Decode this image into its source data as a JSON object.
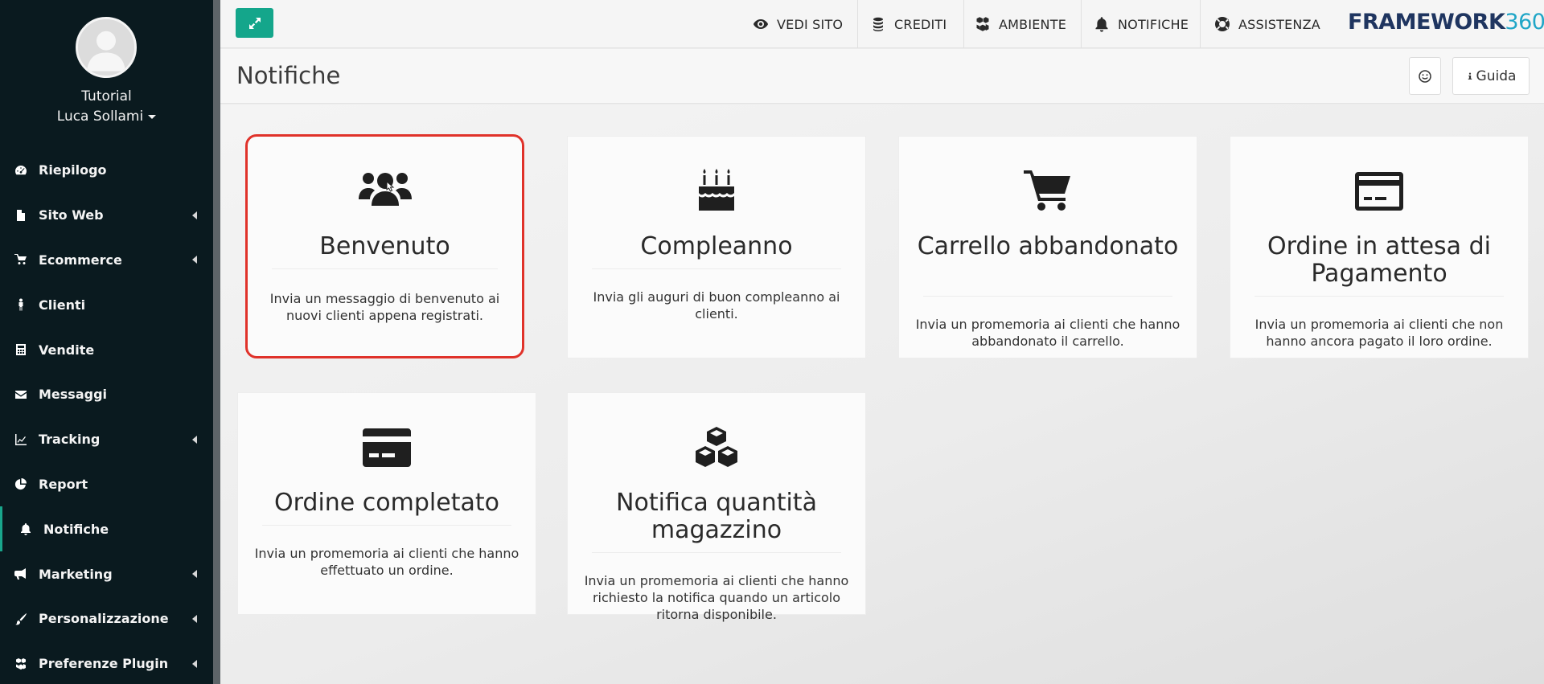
{
  "sidebar": {
    "user": {
      "company": "Tutorial",
      "name": "Luca Sollami"
    },
    "items": [
      {
        "label": "Riepilogo",
        "icon": "dashboard-icon",
        "has_arrow": false
      },
      {
        "label": "Sito Web",
        "icon": "file-icon",
        "has_arrow": true
      },
      {
        "label": "Ecommerce",
        "icon": "cart-icon",
        "has_arrow": true
      },
      {
        "label": "Clienti",
        "icon": "male-icon",
        "has_arrow": false
      },
      {
        "label": "Vendite",
        "icon": "calculator-icon",
        "has_arrow": false
      },
      {
        "label": "Messaggi",
        "icon": "envelope-icon",
        "has_arrow": false
      },
      {
        "label": "Tracking",
        "icon": "line-chart-icon",
        "has_arrow": true
      },
      {
        "label": "Report",
        "icon": "pie-chart-icon",
        "has_arrow": false
      },
      {
        "label": "Notifiche",
        "icon": "bell-icon",
        "has_arrow": false,
        "active": true
      },
      {
        "label": "Marketing",
        "icon": "bullhorn-icon",
        "has_arrow": true
      },
      {
        "label": "Personalizzazione",
        "icon": "brush-icon",
        "has_arrow": true
      },
      {
        "label": "Preferenze Plugin",
        "icon": "cubes-icon",
        "has_arrow": true
      }
    ]
  },
  "topbar": {
    "links": [
      {
        "label": "VEDI SITO",
        "icon": "eye-icon"
      },
      {
        "label": "CREDITI",
        "icon": "coins-icon"
      },
      {
        "label": "AMBIENTE",
        "icon": "cubes-icon"
      },
      {
        "label": "NOTIFICHE",
        "icon": "bell-icon"
      },
      {
        "label": "ASSISTENZA",
        "icon": "lifebuoy-icon"
      }
    ],
    "logo_main": "FRAMEWORK",
    "logo_num": "360"
  },
  "header": {
    "title": "Notifiche",
    "guide_label": "Guida"
  },
  "cards": [
    {
      "title": "Benvenuto",
      "description": "Invia un messaggio di benvenuto ai nuovi clienti appena registrati.",
      "icon": "users-icon",
      "selected": true
    },
    {
      "title": "Compleanno",
      "description": "Invia gli auguri di buon compleanno ai clienti.",
      "icon": "birthday-cake-icon"
    },
    {
      "title": "Carrello abbandonato",
      "description": "Invia un promemoria ai clienti che hanno abbandonato il carrello.",
      "icon": "shopping-cart-icon"
    },
    {
      "title": "Ordine in attesa di Pagamento",
      "description": "Invia un promemoria ai clienti che non hanno ancora pagato il loro ordine.",
      "icon": "credit-card-outline-icon"
    },
    {
      "title": "Ordine completato",
      "description": "Invia un promemoria ai clienti che hanno effettuato un ordine.",
      "icon": "credit-card-icon"
    },
    {
      "title": "Notifica quantità magazzino",
      "description": "Invia un promemoria ai clienti che hanno richiesto la notifica quando un articolo ritorna disponibile.",
      "icon": "cubes-icon"
    }
  ],
  "colors": {
    "accent": "#14a68b",
    "sidebar_bg": "#0a1a1f",
    "selected_border": "#e0322a",
    "logo_blue": "#1f3560",
    "logo_cyan": "#20a6c7"
  }
}
